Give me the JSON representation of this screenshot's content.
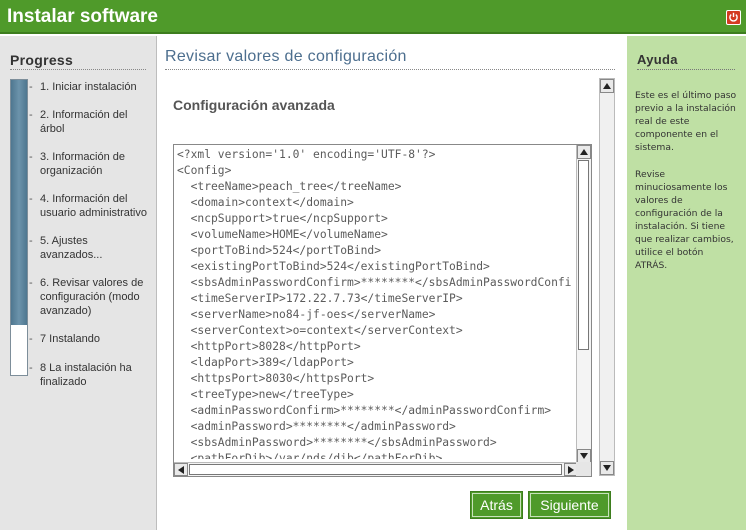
{
  "window": {
    "title": "Instalar software",
    "close_icon": "power-icon"
  },
  "progress": {
    "heading": "Progress",
    "fill_fraction": 0.83,
    "steps": [
      "1. Iniciar instalación",
      "2. Información del árbol",
      "3. Información de organización",
      "4. Información del usuario administrativo",
      "5. Ajustes avanzados...",
      "6. Revisar valores de configuración (modo avanzado)",
      "7 Instalando",
      "8 La instalación ha finalizado"
    ]
  },
  "main": {
    "heading": "Revisar valores de configuración",
    "subheading": "Configuración avanzada",
    "xml_lines": [
      "<?xml version='1.0' encoding='UTF-8'?>",
      "<Config>",
      "  <treeName>peach_tree</treeName>",
      "  <domain>context</domain>",
      "  <ncpSupport>true</ncpSupport>",
      "  <volumeName>HOME</volumeName>",
      "  <portToBind>524</portToBind>",
      "  <existingPortToBind>524</existingPortToBind>",
      "  <sbsAdminPasswordConfirm>********</sbsAdminPasswordConfirm>",
      "  <timeServerIP>172.22.7.73</timeServerIP>",
      "  <serverName>no84-jf-oes</serverName>",
      "  <serverContext>o=context</serverContext>",
      "  <httpPort>8028</httpPort>",
      "  <ldapPort>389</ldapPort>",
      "  <httpsPort>8030</httpsPort>",
      "  <treeType>new</treeType>",
      "  <adminPasswordConfirm>********</adminPasswordConfirm>",
      "  <adminPassword>********</adminPassword>",
      "  <sbsAdminPassword>********</sbsAdminPassword>",
      "  <pathForDib>/var/nds/dib</pathForDib>"
    ],
    "back_label": "Atrás",
    "next_label": "Siguiente"
  },
  "help": {
    "heading": "Ayuda",
    "para1": "Este es el último paso previo a la instalación real de este componente en el sistema.",
    "para2": "Revise minuciosamente los valores de configuración de la instalación. Si tiene que realizar cambios, utilice el botón ATRÁS."
  },
  "colors": {
    "accent": "#4f9a2a",
    "help_bg": "#bfe0a4",
    "progress_fill": "#5a829b"
  }
}
